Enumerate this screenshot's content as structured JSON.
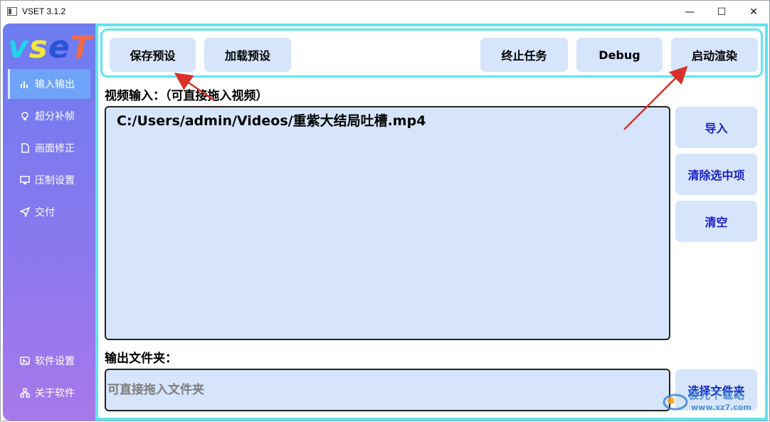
{
  "window": {
    "title": "VSET 3.1.2",
    "controls": {
      "minimize": "—",
      "maximize": "☐",
      "close": "✕"
    }
  },
  "sidebar": {
    "logo": {
      "text": [
        "v",
        "s",
        "e",
        "T"
      ],
      "colors": [
        "#21d4e8",
        "#f4e63a",
        "#2a53d9",
        "#f06b4a"
      ]
    },
    "items": [
      {
        "label": "输入输出",
        "icon": "bar-chart-icon",
        "active": true
      },
      {
        "label": "超分补帧",
        "icon": "bulb-icon",
        "active": false
      },
      {
        "label": "画面修正",
        "icon": "document-icon",
        "active": false
      },
      {
        "label": "压制设置",
        "icon": "monitor-icon",
        "active": false
      },
      {
        "label": "交付",
        "icon": "send-icon",
        "active": false
      },
      {
        "label": "软件设置",
        "icon": "image-settings-icon",
        "active": false
      },
      {
        "label": "关于软件",
        "icon": "org-chart-icon",
        "active": false
      }
    ]
  },
  "toolbar": {
    "save_preset": "保存预设",
    "load_preset": "加载预设",
    "stop_task": "终止任务",
    "debug": "Debug",
    "start_render": "启动渲染"
  },
  "input": {
    "label": "视频输入：（可直接拖入视频）",
    "files": [
      "C:/Users/admin/Videos/重紫大结局吐槽.mp4"
    ],
    "buttons": {
      "import": "导入",
      "clear_selected": "清除选中项",
      "clear_all": "清空"
    }
  },
  "output": {
    "label": "输出文件夹：",
    "placeholder": "可直接拖入文件夹",
    "choose_folder": "选择文件夹"
  },
  "watermark": {
    "text": "极光下载站",
    "url": "www.xz7.com"
  },
  "colors": {
    "accent_cyan": "#5fe4ef",
    "button_bg": "#d6e5fb",
    "side_button_text": "#1a1fc8",
    "annotation_arrow": "#d9302a"
  }
}
